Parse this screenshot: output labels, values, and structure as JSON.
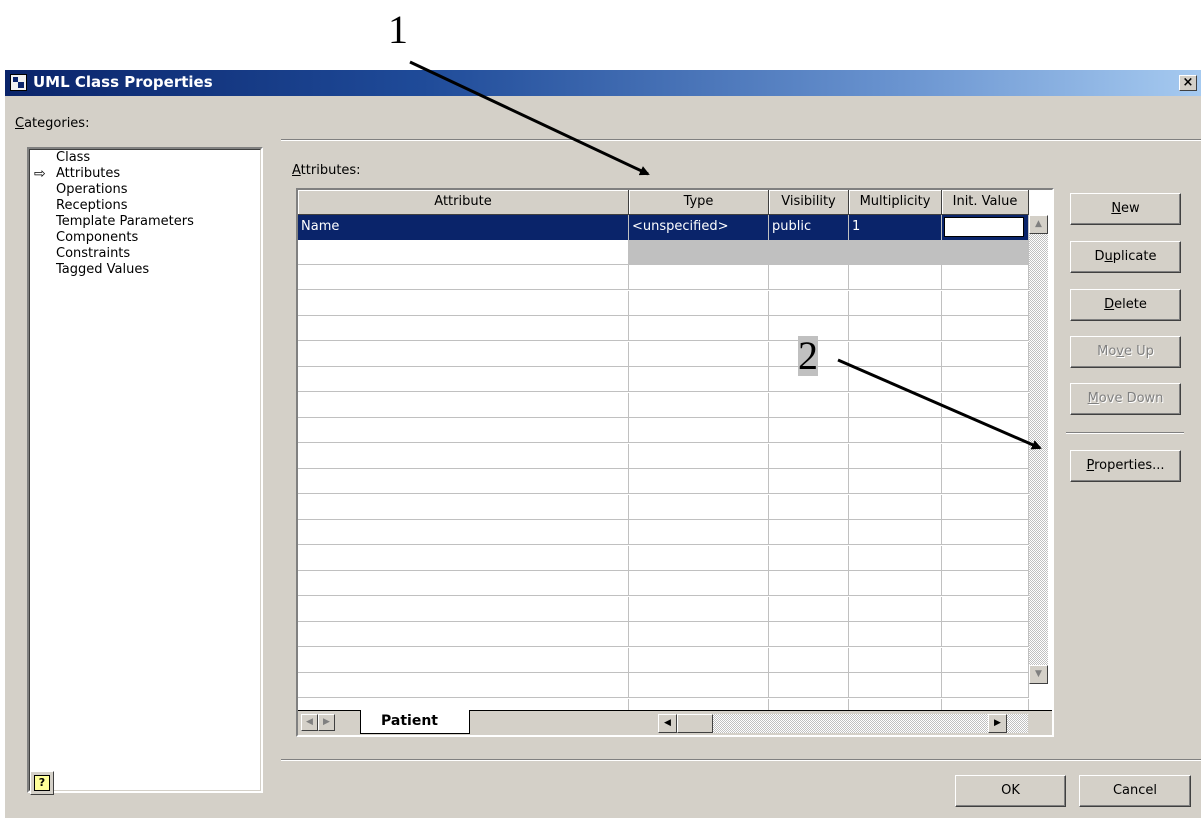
{
  "annotations": {
    "label_1": "1",
    "label_2": "2"
  },
  "dialog": {
    "title": "UML Class Properties",
    "close_label": "×"
  },
  "categories": {
    "label_accel": "C",
    "label_rest": "ategories:",
    "items": [
      "Class",
      "Attributes",
      "Operations",
      "Receptions",
      "Template Parameters",
      "Components",
      "Constraints",
      "Tagged Values"
    ],
    "selected_marker": "⇨"
  },
  "attributes": {
    "label_accel": "A",
    "label_rest": "ttributes:",
    "columns": [
      "Attribute",
      "Type",
      "Visibility",
      "Multiplicity",
      "Init. Value"
    ],
    "rows": [
      {
        "attribute": "Name",
        "type": "<unspecified>",
        "visibility": "public",
        "multiplicity": "1",
        "init_value": ""
      }
    ],
    "sheet_tab": "Patient"
  },
  "buttons": {
    "new_accel": "N",
    "new_rest": "ew",
    "duplicate_pre": "D",
    "duplicate_accel": "u",
    "duplicate_rest": "plicate",
    "delete_accel": "D",
    "delete_rest": "elete",
    "move_up_pre": "Mo",
    "move_up_accel": "v",
    "move_up_rest": "e Up",
    "move_down_accel": "M",
    "move_down_rest": "ove Down",
    "properties_accel": "P",
    "properties_rest": "roperties...",
    "ok": "OK",
    "cancel": "Cancel",
    "help": "?"
  },
  "colors": {
    "selection": "#0a246a",
    "dialog_bg": "#d4d0c8",
    "title_start": "#0a246a",
    "title_end": "#a6caf0"
  }
}
